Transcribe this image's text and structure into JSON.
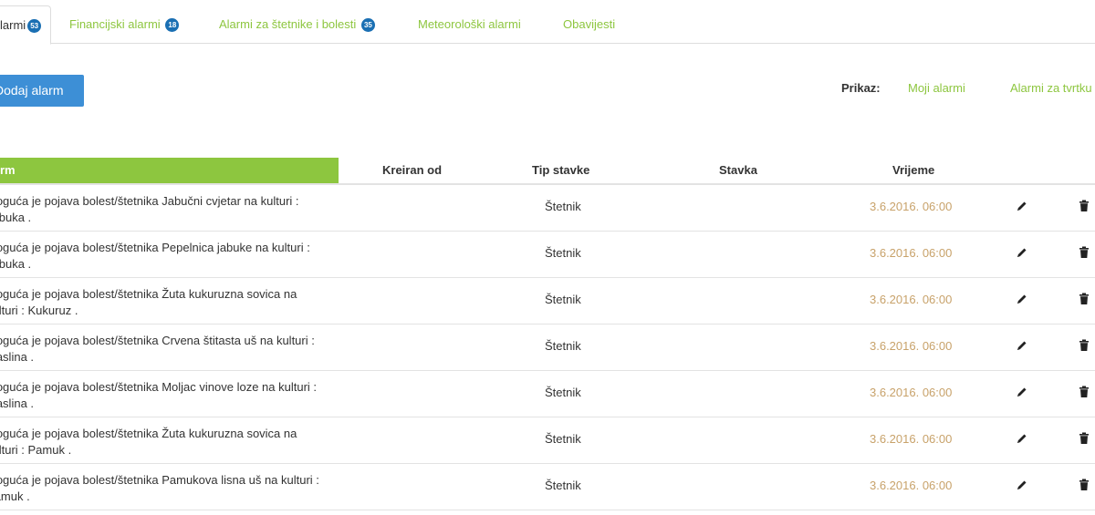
{
  "tabs": [
    {
      "label": "larmi",
      "badge": "53",
      "active": true
    },
    {
      "label": "Financijski alarmi",
      "badge": "18",
      "active": false
    },
    {
      "label": "Alarmi za štetnike i bolesti",
      "badge": "35",
      "active": false
    },
    {
      "label": "Meteorološki alarmi",
      "badge": "",
      "active": false
    },
    {
      "label": "Obavijesti",
      "badge": "",
      "active": false
    }
  ],
  "toolbar": {
    "add_label": "Dodaj alarm",
    "prikaz_label": "Prikaz:",
    "filters": [
      "Moji alarmi",
      "Alarmi za tvrtku"
    ]
  },
  "table": {
    "columns": [
      "rm",
      "Kreiran od",
      "Tip stavke",
      "Stavka",
      "Vrijeme"
    ],
    "rows": [
      {
        "alarm": "Moguća je pojava bolest/štetnika Jabučni cvjetar na kulturi : Jabuka .",
        "kreiran_od": "",
        "tip": "Štetnik",
        "stavka": "",
        "vrijeme": "3.6.2016. 06:00"
      },
      {
        "alarm": "Moguća je pojava bolest/štetnika Pepelnica jabuke na kulturi : Jabuka .",
        "kreiran_od": "",
        "tip": "Štetnik",
        "stavka": "",
        "vrijeme": "3.6.2016. 06:00"
      },
      {
        "alarm": "Moguća je pojava bolest/štetnika Žuta kukuruzna sovica na kulturi : Kukuruz .",
        "kreiran_od": "",
        "tip": "Štetnik",
        "stavka": "",
        "vrijeme": "3.6.2016. 06:00"
      },
      {
        "alarm": "Moguća je pojava bolest/štetnika Crvena štitasta uš na kulturi : Maslina .",
        "kreiran_od": "",
        "tip": "Štetnik",
        "stavka": "",
        "vrijeme": "3.6.2016. 06:00"
      },
      {
        "alarm": "Moguća je pojava bolest/štetnika Moljac vinove loze na kulturi : Maslina .",
        "kreiran_od": "",
        "tip": "Štetnik",
        "stavka": "",
        "vrijeme": "3.6.2016. 06:00"
      },
      {
        "alarm": "Moguća je pojava bolest/štetnika Žuta kukuruzna sovica na kulturi : Pamuk .",
        "kreiran_od": "",
        "tip": "Štetnik",
        "stavka": "",
        "vrijeme": "3.6.2016. 06:00"
      },
      {
        "alarm": "Moguća je pojava bolest/štetnika Pamukova lisna uš na kulturi : Pamuk .",
        "kreiran_od": "",
        "tip": "Štetnik",
        "stavka": "",
        "vrijeme": "3.6.2016. 06:00"
      }
    ]
  },
  "colors": {
    "accent_green": "#8dc63f",
    "button_blue": "#3d8fd6",
    "badge_blue": "#1a6fb3",
    "time_color": "#c8a26a"
  },
  "icons": {
    "edit": "pencil-icon",
    "delete": "trash-icon"
  }
}
